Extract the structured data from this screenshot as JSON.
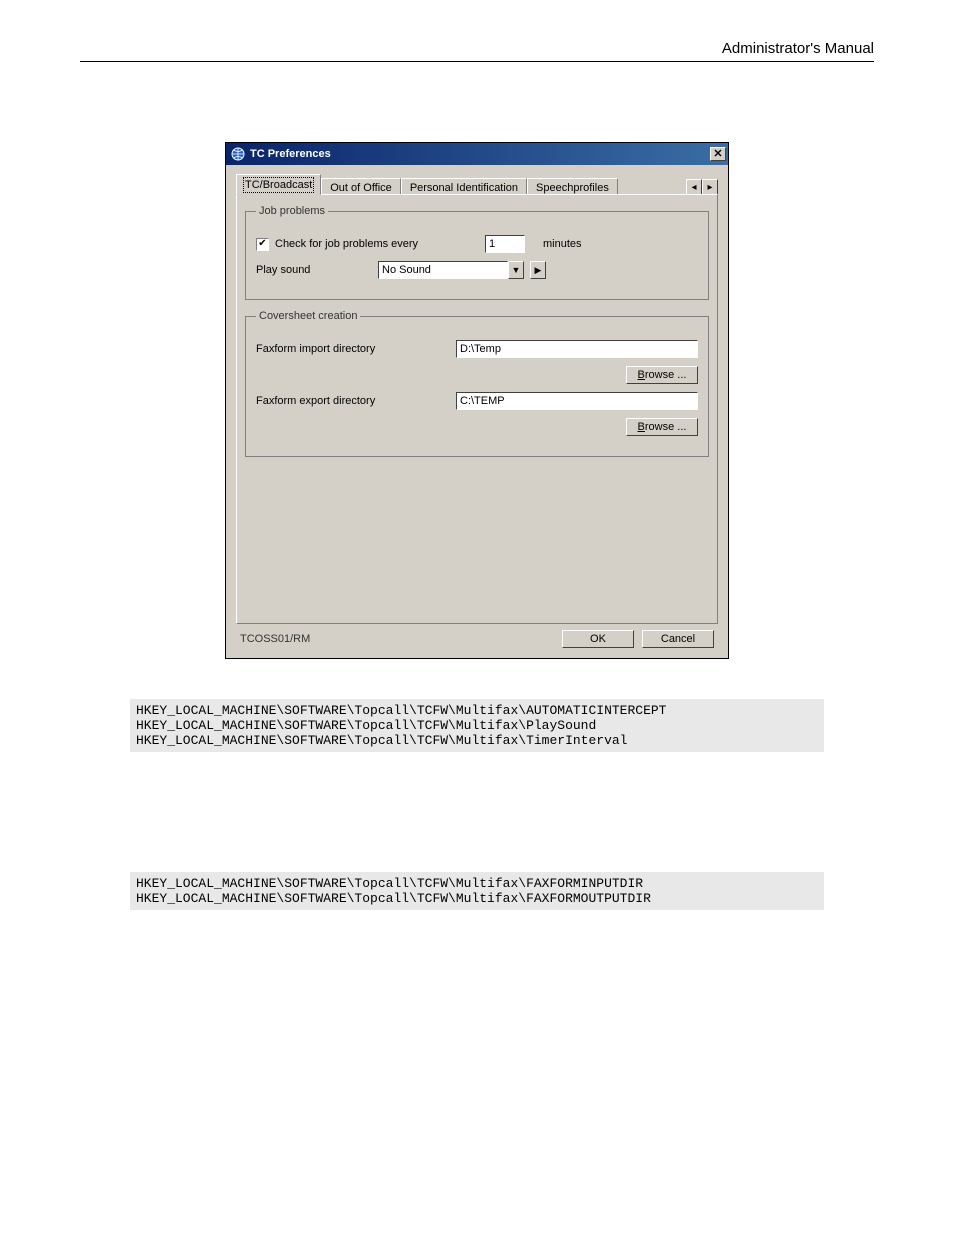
{
  "header": {
    "right": "Administrator's Manual"
  },
  "dialog": {
    "title": "TC Preferences",
    "tabs": [
      "TC/Broadcast",
      "Out of Office",
      "Personal Identification",
      "Speechprofiles"
    ],
    "active_tab_index": 0,
    "job_problems": {
      "legend": "Job problems",
      "check_label": "Check for job problems every",
      "check_value": true,
      "interval_value": "1",
      "interval_unit": "minutes",
      "play_sound_label": "Play sound",
      "play_sound_value": "No Sound"
    },
    "coversheet": {
      "legend": "Coversheet creation",
      "import_label": "Faxform import directory",
      "import_value": "D:\\Temp",
      "export_label": "Faxform export directory",
      "export_value": "C:\\TEMP",
      "browse_label": "Browse ..."
    },
    "status": "TCOSS01/RM",
    "ok_label": "OK",
    "cancel_label": "Cancel"
  },
  "registry1": "HKEY_LOCAL_MACHINE\\SOFTWARE\\Topcall\\TCFW\\Multifax\\AUTOMATICINTERCEPT\nHKEY_LOCAL_MACHINE\\SOFTWARE\\Topcall\\TCFW\\Multifax\\PlaySound\nHKEY_LOCAL_MACHINE\\SOFTWARE\\Topcall\\TCFW\\Multifax\\TimerInterval",
  "registry2": "HKEY_LOCAL_MACHINE\\SOFTWARE\\Topcall\\TCFW\\Multifax\\FAXFORMINPUTDIR\nHKEY_LOCAL_MACHINE\\SOFTWARE\\Topcall\\TCFW\\Multifax\\FAXFORMOUTPUTDIR"
}
